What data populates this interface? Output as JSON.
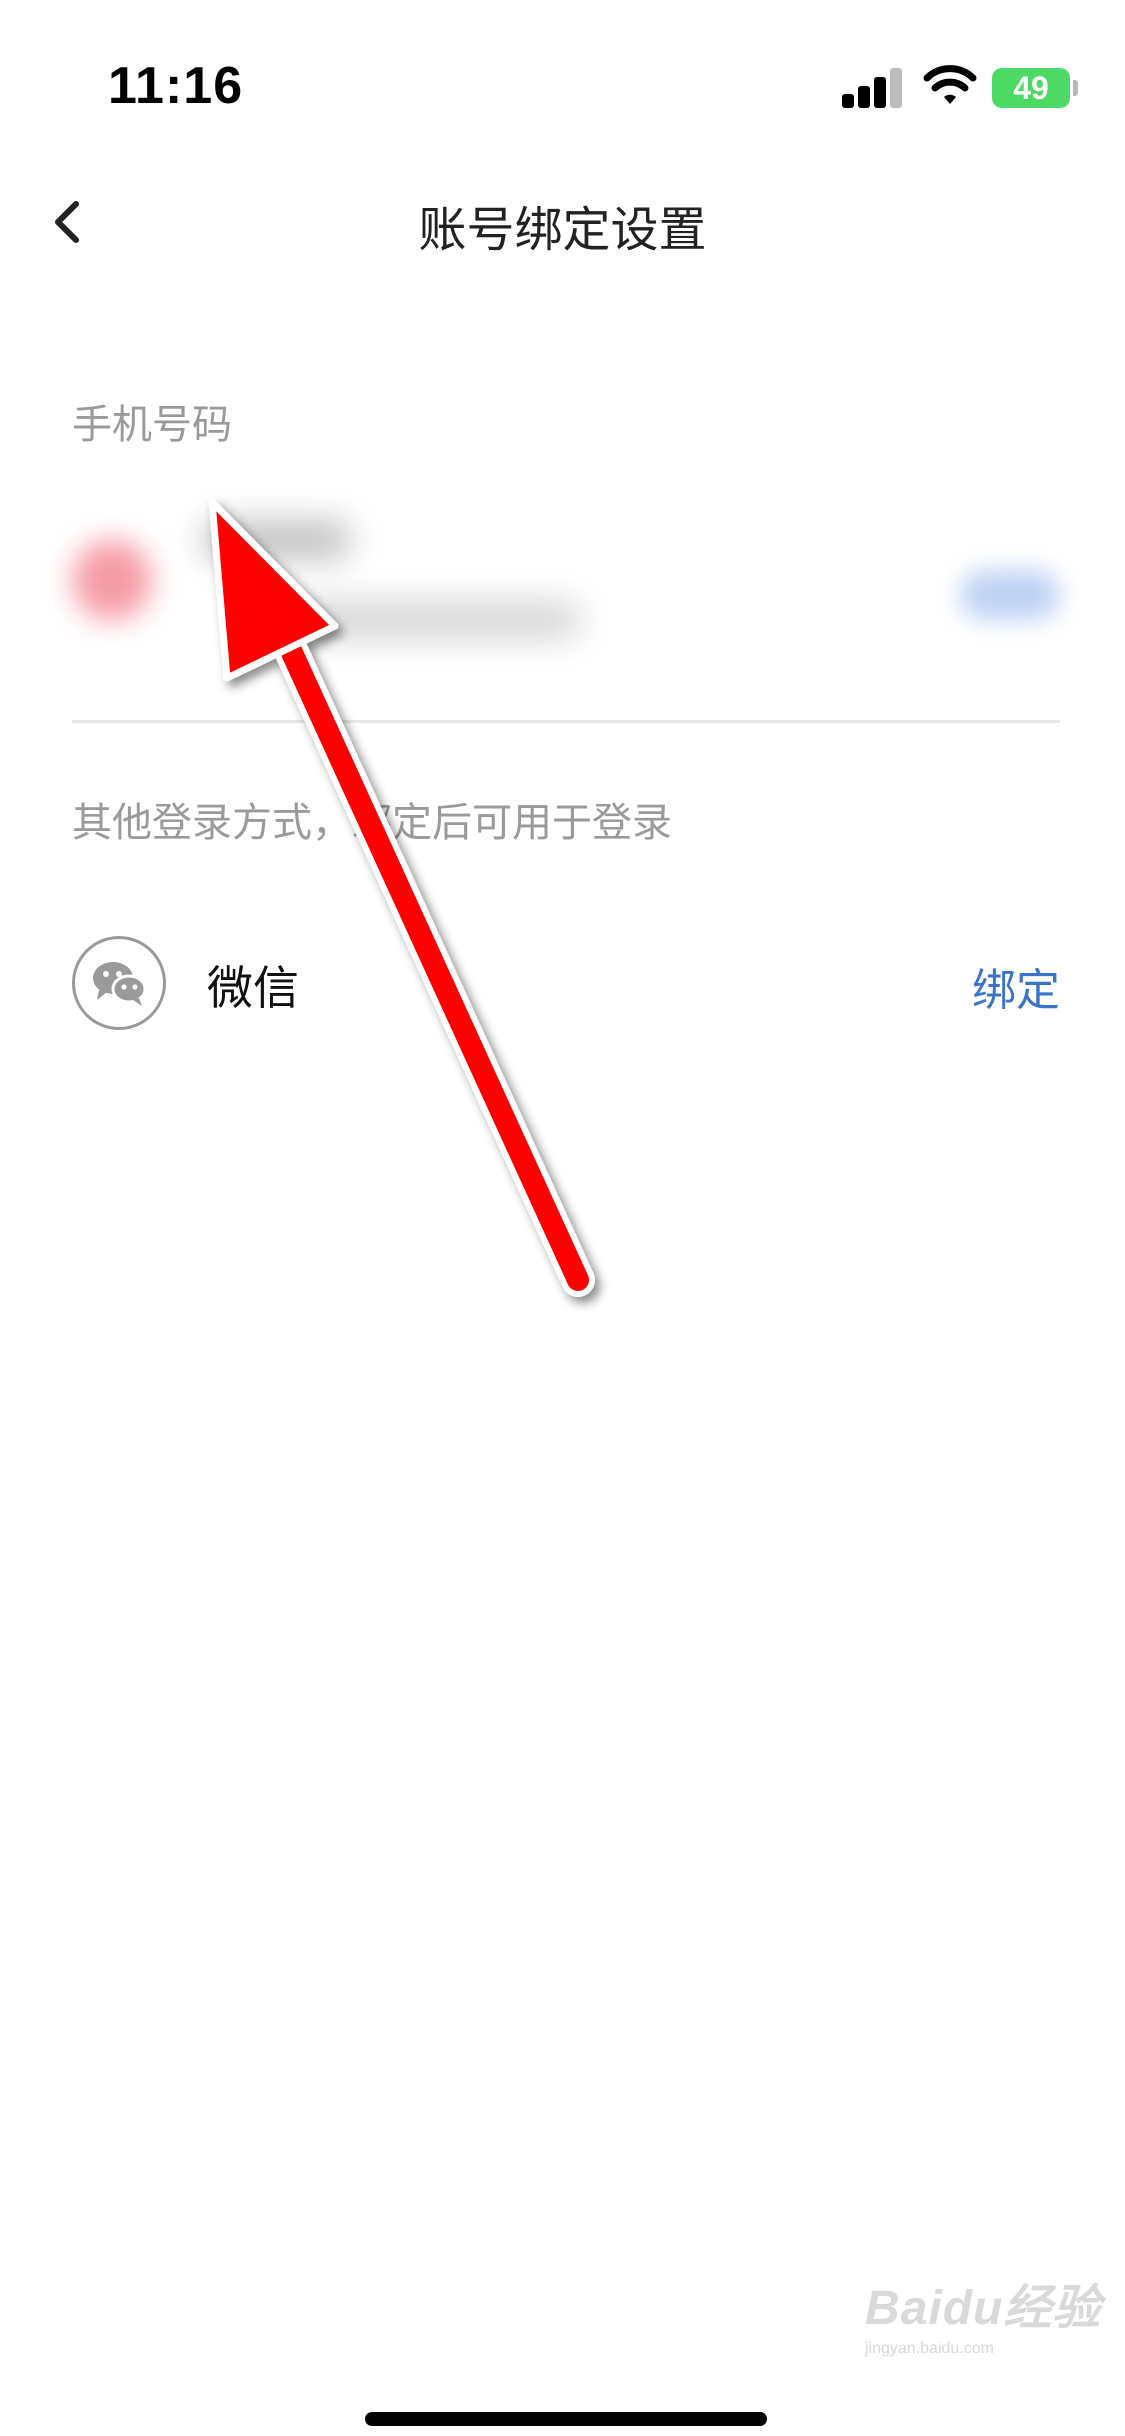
{
  "status_bar": {
    "time": "11:16",
    "battery_level": "49",
    "battery_color": "#4cd964"
  },
  "nav": {
    "title": "账号绑定设置",
    "back_icon": "chevron-left-icon"
  },
  "phone_section": {
    "label": "手机号码"
  },
  "other_section": {
    "label": "其他登录方式，绑定后可用于登录"
  },
  "wechat": {
    "icon": "wechat-icon",
    "label": "微信",
    "action_label": "绑定",
    "action_color": "#3b73c8"
  },
  "watermark": {
    "brand": "Baidu经验",
    "site": "jingyan.baidu.com"
  },
  "annotation": {
    "icon": "red-arrow-icon",
    "color": "#ff0000"
  }
}
